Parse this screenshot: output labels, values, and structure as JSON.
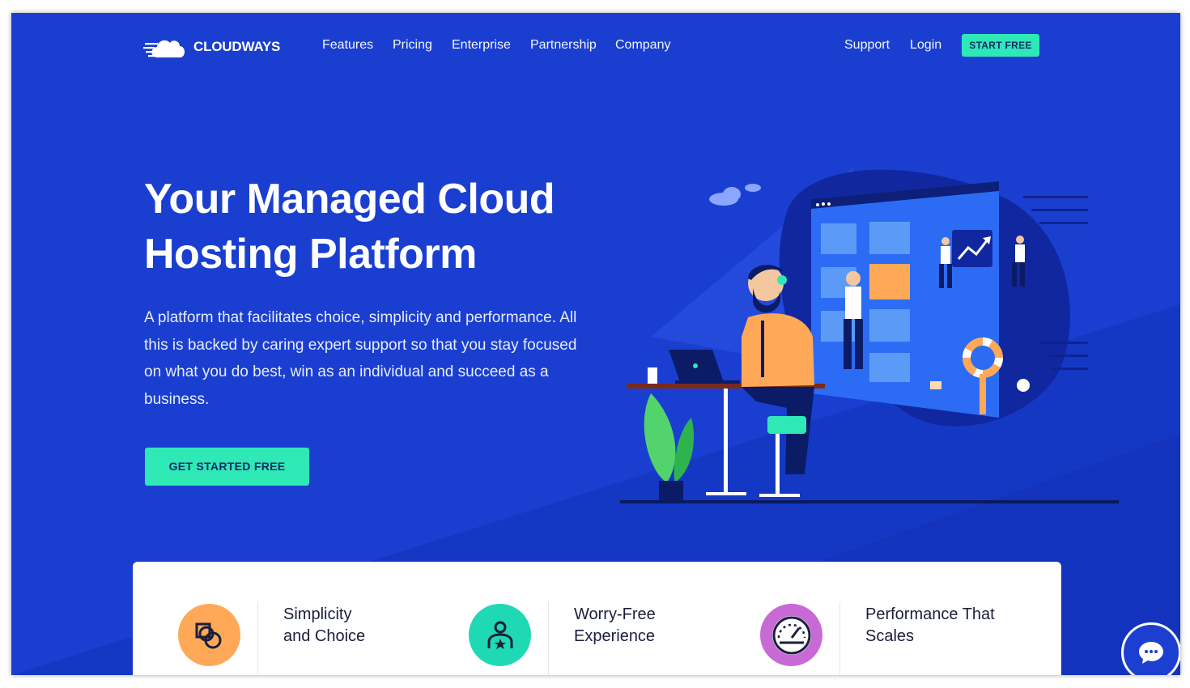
{
  "brand": {
    "name": "CLOUDWAYS",
    "accent": "#2ee8b6",
    "background": "#1a3fd0"
  },
  "nav": {
    "links": [
      "Features",
      "Pricing",
      "Enterprise",
      "Partnership",
      "Company"
    ],
    "right_links": [
      "Support",
      "Login"
    ],
    "cta_label": "START FREE"
  },
  "hero": {
    "title_line1": "Your Managed Cloud",
    "title_line2": "Hosting Platform",
    "description": "A platform that facilitates choice, simplicity and performance. All this is backed by caring expert support so that you stay focused on what you do best, win as an individual and succeed as a business.",
    "cta_label": "GET STARTED FREE"
  },
  "features": [
    {
      "title_line1": "Simplicity",
      "title_line2": "and Choice",
      "icon": "shapes-icon",
      "color": "#ffa958"
    },
    {
      "title_line1": "Worry-Free",
      "title_line2": "Experience",
      "icon": "user-star-icon",
      "color": "#1fd9b5"
    },
    {
      "title_line1": "Performance That",
      "title_line2": "Scales",
      "icon": "speedometer-icon",
      "color": "#c86ad6"
    }
  ],
  "chat": {
    "icon": "chat-bubble-icon"
  }
}
